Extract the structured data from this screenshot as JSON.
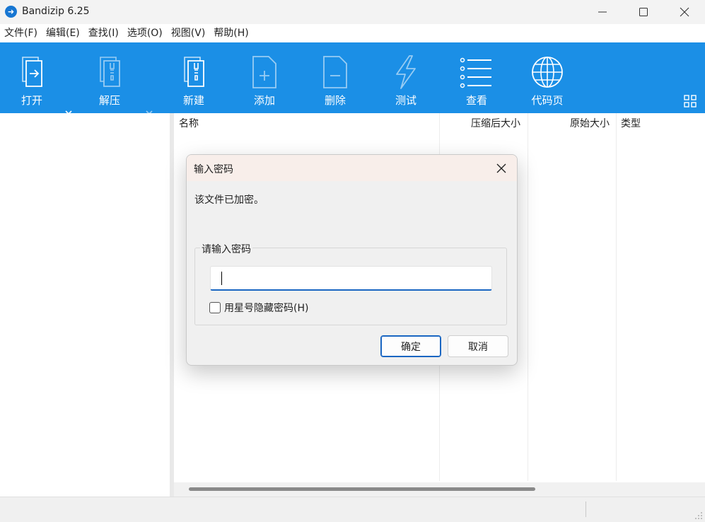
{
  "window": {
    "title": "Bandizip 6.25",
    "minimize": "—",
    "maximize": "☐",
    "close": "✕"
  },
  "menu": [
    "文件(F)",
    "编辑(E)",
    "查找(I)",
    "选项(O)",
    "视图(V)",
    "帮助(H)"
  ],
  "toolbar": {
    "open": "打开",
    "extract": "解压",
    "new": "新建",
    "add": "添加",
    "delete": "删除",
    "test": "测试",
    "view": "查看",
    "codepage": "代码页",
    "accent_color": "#1b8fe6"
  },
  "list": {
    "columns": [
      "名称",
      "压缩后大小",
      "原始大小",
      "类型"
    ]
  },
  "dialog": {
    "title": "输入密码",
    "message": "该文件已加密。",
    "group_label": "请输入密码",
    "password_value": "",
    "hide_checkbox_label": "用星号隐藏密码(H)",
    "hide_checked": false,
    "ok": "确定",
    "cancel": "取消"
  }
}
